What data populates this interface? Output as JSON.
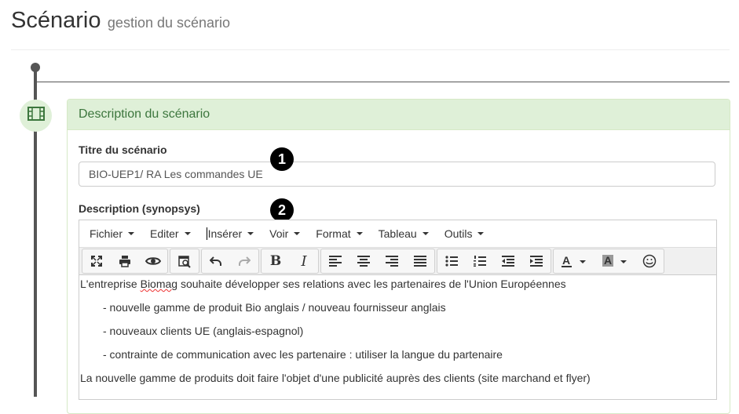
{
  "header": {
    "title": "Scénario",
    "subtitle": "gestion du scénario"
  },
  "panel": {
    "heading": "Description du scénario"
  },
  "form": {
    "title_label": "Titre du scénario",
    "title_value": "BIO-UEP1/ RA Les commandes UE",
    "description_label": "Description (synopsys)"
  },
  "markers": [
    "1",
    "2"
  ],
  "editor": {
    "menu": [
      "Fichier",
      "Editer",
      "Insérer",
      "Voir",
      "Format",
      "Tableau",
      "Outils"
    ],
    "toolbar_icons": [
      "fullscreen-icon",
      "print-icon",
      "preview-icon",
      "search-replace-icon",
      "undo-icon",
      "redo-icon",
      "bold-icon",
      "italic-icon",
      "align-left-icon",
      "align-center-icon",
      "align-right-icon",
      "align-justify-icon",
      "bullet-list-icon",
      "numbered-list-icon",
      "outdent-icon",
      "indent-icon",
      "text-color-icon",
      "background-color-icon",
      "emoticons-icon"
    ],
    "content": {
      "line1_pre": "L'entreprise ",
      "line1_word": "Biomag",
      "line1_post": " souhaite développer ses relations avec les partenaires de l'Union Européennes",
      "line2": "- nouvelle gamme de produit Bio anglais / nouveau fournisseur anglais",
      "line3": "- nouveaux clients UE (anglais-espagnol)",
      "line4": "- contrainte de communication avec les partenaire : utiliser la langue du partenaire",
      "line5": "La nouvelle gamme de produits doit faire l'objet d'une publicité auprès des clients (site marchand et flyer)"
    }
  },
  "colors": {
    "panel_bg": "#dff0d8",
    "panel_text": "#3c763d",
    "timeline": "#555555"
  }
}
